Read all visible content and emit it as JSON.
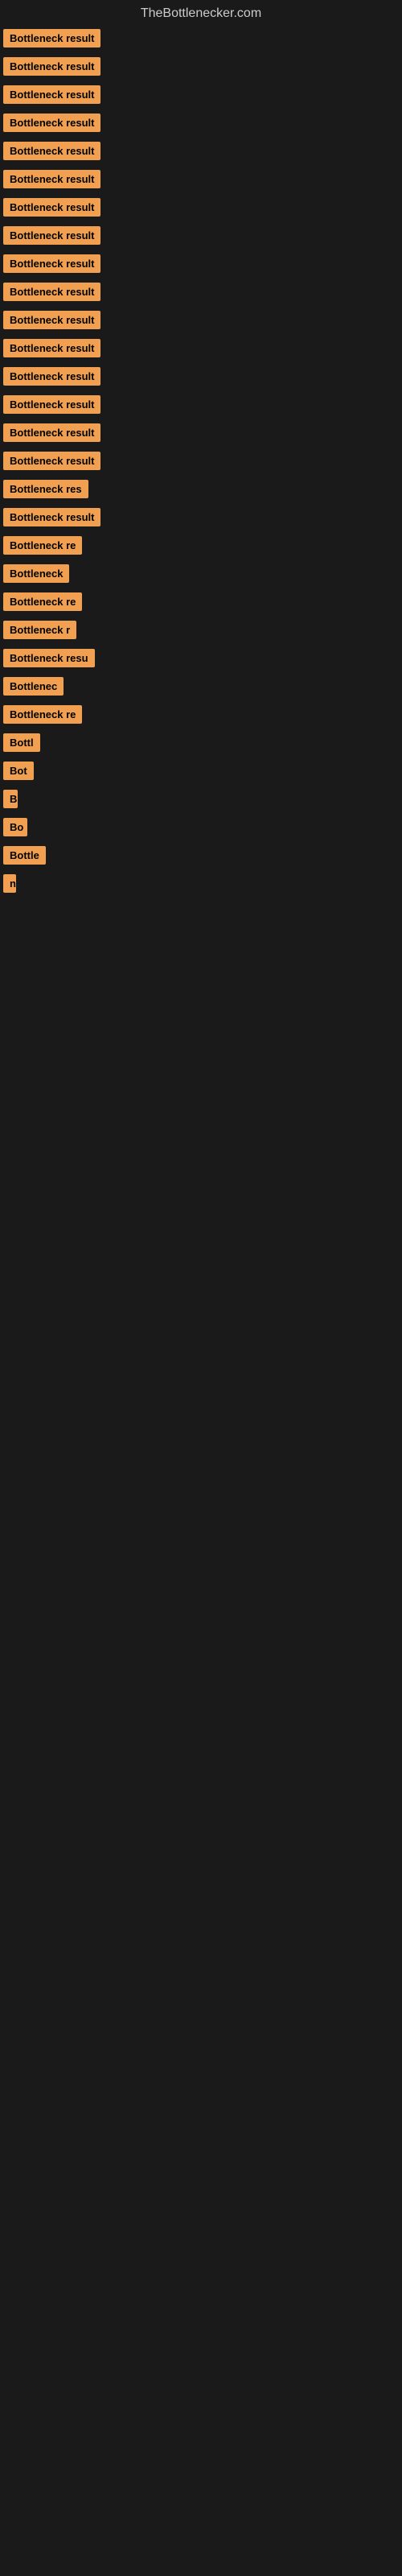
{
  "site_title": "TheBottlenecker.com",
  "items": [
    {
      "label": "Bottleneck result",
      "width": 130
    },
    {
      "label": "Bottleneck result",
      "width": 130
    },
    {
      "label": "Bottleneck result",
      "width": 130
    },
    {
      "label": "Bottleneck result",
      "width": 130
    },
    {
      "label": "Bottleneck result",
      "width": 130
    },
    {
      "label": "Bottleneck result",
      "width": 130
    },
    {
      "label": "Bottleneck result",
      "width": 130
    },
    {
      "label": "Bottleneck result",
      "width": 130
    },
    {
      "label": "Bottleneck result",
      "width": 130
    },
    {
      "label": "Bottleneck result",
      "width": 130
    },
    {
      "label": "Bottleneck result",
      "width": 130
    },
    {
      "label": "Bottleneck result",
      "width": 130
    },
    {
      "label": "Bottleneck result",
      "width": 130
    },
    {
      "label": "Bottleneck result",
      "width": 130
    },
    {
      "label": "Bottleneck result",
      "width": 130
    },
    {
      "label": "Bottleneck result",
      "width": 130
    },
    {
      "label": "Bottleneck res",
      "width": 112
    },
    {
      "label": "Bottleneck result",
      "width": 130
    },
    {
      "label": "Bottleneck re",
      "width": 108
    },
    {
      "label": "Bottleneck",
      "width": 90
    },
    {
      "label": "Bottleneck re",
      "width": 108
    },
    {
      "label": "Bottleneck r",
      "width": 100
    },
    {
      "label": "Bottleneck resu",
      "width": 116
    },
    {
      "label": "Bottlenec",
      "width": 85
    },
    {
      "label": "Bottleneck re",
      "width": 108
    },
    {
      "label": "Bottl",
      "width": 55
    },
    {
      "label": "Bot",
      "width": 45
    },
    {
      "label": "B",
      "width": 18
    },
    {
      "label": "Bo",
      "width": 30
    },
    {
      "label": "Bottle",
      "width": 58
    },
    {
      "label": "n",
      "width": 14
    }
  ]
}
